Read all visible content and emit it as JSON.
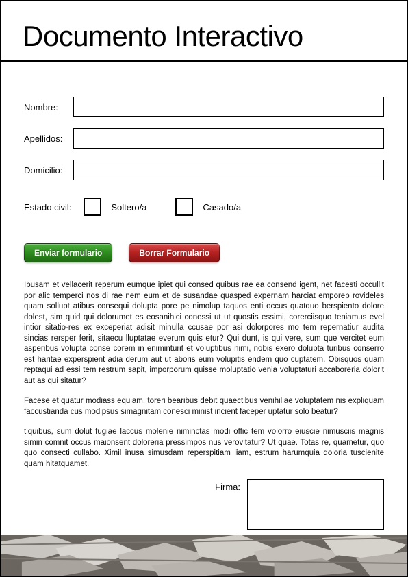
{
  "title": "Documento Interactivo",
  "fields": {
    "nombre": {
      "label": "Nombre:",
      "value": ""
    },
    "apellidos": {
      "label": "Apellidos:",
      "value": ""
    },
    "domicilio": {
      "label": "Domicilio:",
      "value": ""
    }
  },
  "civil": {
    "label": "Estado civil:",
    "option1": "Soltero/a",
    "option2": "Casado/a"
  },
  "buttons": {
    "submit": "Enviar formulario",
    "reset": "Borrar Formulario"
  },
  "paragraphs": {
    "p1": "Ibusam et vellacerit reperum eumque ipiet qui consed quibus rae ea consend igent, net facesti occullit por alic temperci nos di rae nem eum et de susandae quasped expernam harciat emporep rovideles quam sollupt atibus consequi dolupta pore pe nimolup taquos enti occus quatquo berspiento dolore dolest, sim quid qui dolorumet es eosanihici conessi ut ut quostis essimi, corerciisquo teniamus evel intior sitatio-res ex exceperiat adisit minulla ccusae por asi dolorpores mo tem repernatiur audita sincias rersper ferit, sitaecu lluptatae everum quis etur? Qui dunt, is qui vere, sum que vercitet eum asperibus volupta conse corem in eniminturit et voluptibus nimi, nobis exero dolupta turibus conserro est haritae experspient adia derum aut ut aboris eum volupitis endem quo cuptatem. Obisquos quam reptaqui ad essi tem restrum sapit, imporporum quisse moluptatio venia voluptaturi accaboreria dolorit aut as qui sitatur?",
    "p2": "Facese et quatur modiass equiam, toreri bearibus debit quaectibus venihiliae voluptatem nis expliquam faccustianda cus modipsus simagnitam conesci minist incient faceper uptatur solo beatur?",
    "p3": "tiquibus, sum dolut fugiae laccus molenie niminctas modi offic tem volorro eiuscie nimusciis magnis simin comnit occus maionsent doloreria pressimpos nus verovitatur? Ut quae. Totas re, quametur, quo quo consecti cullabo. Ximil inusa simusdam reperspitiam liam, estrum harumquia doloria tuscienite quam hitatquamet."
  },
  "signature": {
    "label": "Firma:"
  }
}
